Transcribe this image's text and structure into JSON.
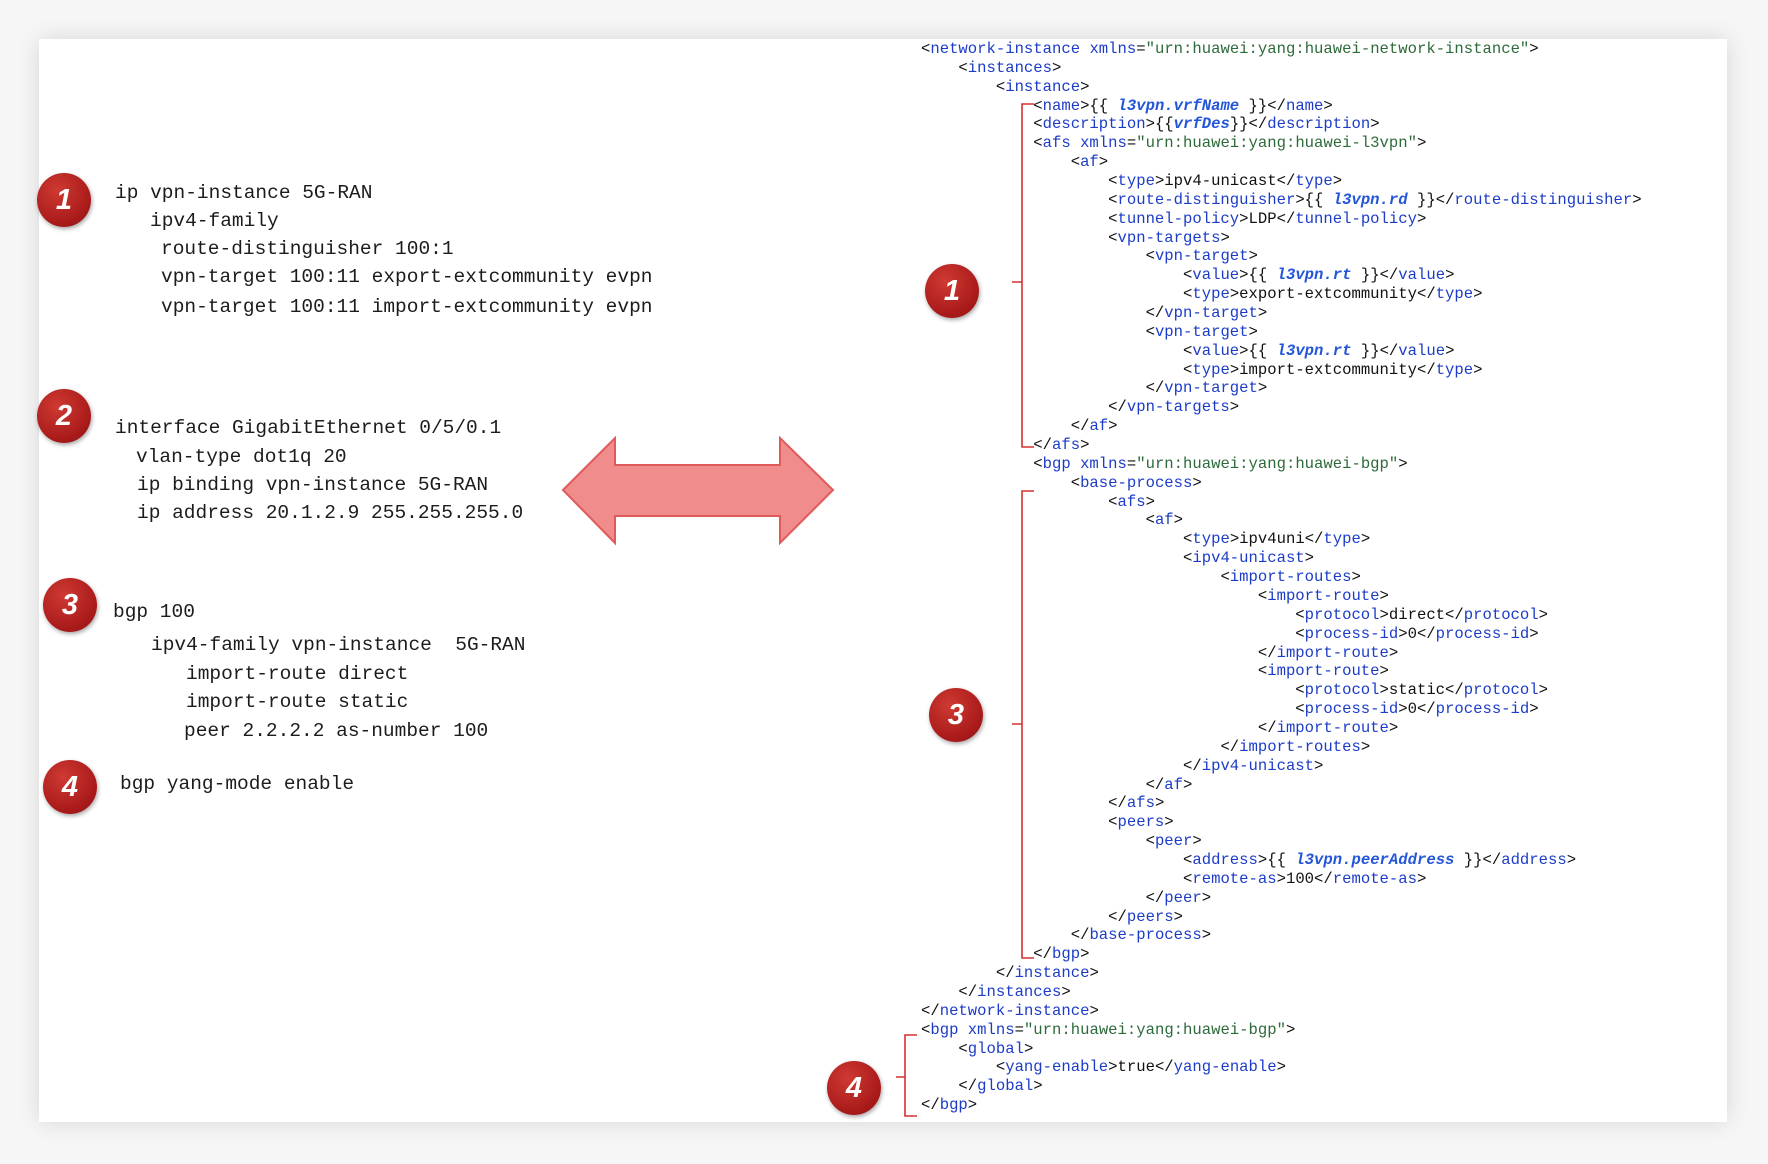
{
  "left_config": [
    {
      "badge": "1",
      "lines": [
        "ip vpn-instance 5G-RAN",
        "ipv4-family",
        "route-distinguisher 100:1",
        "vpn-target 100:11 export-extcommunity evpn",
        "vpn-target 100:11 import-extcommunity evpn"
      ]
    },
    {
      "badge": "2",
      "lines": [
        "interface GigabitEthernet 0/5/0.1",
        "vlan-type dot1q 20",
        "ip binding vpn-instance 5G-RAN",
        "ip address 20.1.2.9 255.255.255.0"
      ]
    },
    {
      "badge": "3",
      "lines": [
        "bgp 100",
        "ipv4-family vpn-instance  5G-RAN",
        "import-route direct",
        "import-route static",
        "peer 2.2.2.2 as-number 100"
      ]
    },
    {
      "badge": "4",
      "lines": [
        "bgp yang-mode enable"
      ]
    }
  ],
  "right_badges": [
    "1",
    "3",
    "4"
  ],
  "xml_lines": [
    "<network-instance xmlns=\"urn:huawei:yang:huawei-network-instance\">",
    "<instances>",
    "<instance>",
    "<name>{{ l3vpn.vrfName }}</name>",
    "<description>{{vrfDes}}</description>",
    "<afs xmlns=\"urn:huawei:yang:huawei-l3vpn\">",
    "<af>",
    "<type>ipv4-unicast</type>",
    "<route-distinguisher>{{ l3vpn.rd }}</route-distinguisher>",
    "<tunnel-policy>LDP</tunnel-policy>",
    "<vpn-targets>",
    "<vpn-target>",
    "<value>{{ l3vpn.rt }}</value>",
    "<type>export-extcommunity</type>",
    "</vpn-target>",
    "<vpn-target>",
    "<value>{{ l3vpn.rt }}</value>",
    "<type>import-extcommunity</type>",
    "</vpn-target>",
    "</vpn-targets>",
    "</af>",
    "</afs>",
    "<bgp xmlns=\"urn:huawei:yang:huawei-bgp\">",
    "<base-process>",
    "<afs>",
    "<af>",
    "<type>ipv4uni</type>",
    "<ipv4-unicast>",
    "<import-routes>",
    "<import-route>",
    "<protocol>direct</protocol>",
    "<process-id>0</process-id>",
    "</import-route>",
    "<import-route>",
    "<protocol>static</protocol>",
    "<process-id>0</process-id>",
    "</import-route>",
    "</import-routes>",
    "</ipv4-unicast>",
    "</af>",
    "</afs>",
    "<peers>",
    "<peer>",
    "<address>{{ l3vpn.peerAddress }}</address>",
    "<remote-as>100</remote-as>",
    "</peer>",
    "</peers>",
    "</base-process>",
    "</bgp>",
    "</instance>",
    "</instances>",
    "</network-instance>",
    "<bgp xmlns=\"urn:huawei:yang:huawei-bgp\">",
    "<global>",
    "<yang-enable>true</yang-enable>",
    "</global>",
    "</bgp>"
  ],
  "colors": {
    "badge": "#a81a1a",
    "arrow_fill": "#f08c8c",
    "arrow_stroke": "#e05a5a",
    "bracket": "#d63030",
    "xml_tag": "#1c3cc8",
    "xml_attr_value": "#2d6a3a",
    "xml_template_var": "#2356d8",
    "text": "#1c1c1c"
  }
}
